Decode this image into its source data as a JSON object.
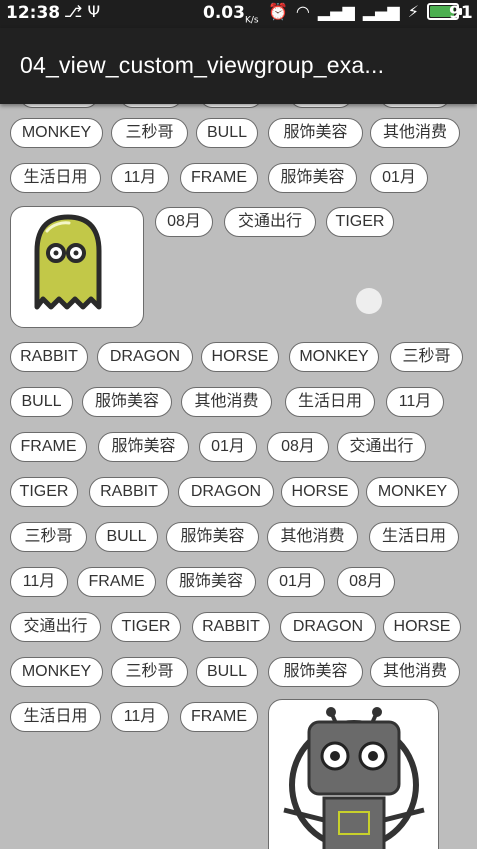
{
  "status": {
    "time": "12:38",
    "speed": "0.03",
    "speed_unit": "K/s",
    "battery_level": "91",
    "battery_fraction": 0.91
  },
  "appbar": {
    "title": "04_view_custom_viewgroup_exa..."
  },
  "tags": [
    "MONKEY",
    "三秒哥",
    "BULL",
    "服饰美容",
    "其他消费",
    "生活日用",
    "11月",
    "FRAME",
    "服饰美容",
    "01月",
    "08月",
    "交通出行",
    "TIGER",
    "RABBIT",
    "DRAGON",
    "HORSE",
    "MONKEY",
    "三秒哥",
    "BULL",
    "服饰美容",
    "其他消费",
    "生活日用",
    "11月",
    "FRAME",
    "服饰美容",
    "01月",
    "08月",
    "交通出行",
    "TIGER",
    "RABBIT",
    "DRAGON",
    "HORSE",
    "MONKEY",
    "三秒哥",
    "BULL",
    "服饰美容",
    "其他消费",
    "生活日用",
    "11月",
    "FRAME",
    "服饰美容",
    "01月",
    "08月",
    "交通出行",
    "TIGER",
    "RABBIT",
    "DRAGON",
    "HORSE",
    "MONKEY",
    "三秒哥",
    "BULL",
    "服饰美容",
    "其他消费",
    "生活日用",
    "11月",
    "FRAME"
  ],
  "colors": {
    "ghost": "#c2c848",
    "ghost_outline": "#2a2a2a",
    "robot_accent": "#c8d12b"
  }
}
